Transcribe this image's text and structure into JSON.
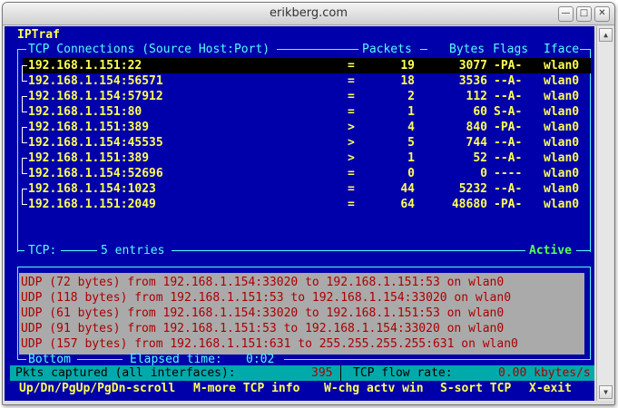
{
  "window": {
    "title": "erikberg.com"
  },
  "app": {
    "name": "IPTraf"
  },
  "header": {
    "conn_label": "TCP Connections (Source Host:Port)",
    "packets": "Packets",
    "bytes": "Bytes",
    "flags": "Flags",
    "iface": "Iface"
  },
  "connections": [
    {
      "host": "192.168.1.151:22",
      "dir": "=",
      "packets": "19",
      "bytes": "3077",
      "flags": "-PA-",
      "iface": "wlan0"
    },
    {
      "host": "192.168.1.154:56571",
      "dir": "=",
      "packets": "18",
      "bytes": "3536",
      "flags": "--A-",
      "iface": "wlan0"
    },
    {
      "host": "192.168.1.154:57912",
      "dir": "=",
      "packets": "2",
      "bytes": "112",
      "flags": "--A-",
      "iface": "wlan0"
    },
    {
      "host": "192.168.1.151:80",
      "dir": "=",
      "packets": "1",
      "bytes": "60",
      "flags": "S-A-",
      "iface": "wlan0"
    },
    {
      "host": "192.168.1.151:389",
      "dir": ">",
      "packets": "4",
      "bytes": "840",
      "flags": "-PA-",
      "iface": "wlan0"
    },
    {
      "host": "192.168.1.154:45535",
      "dir": ">",
      "packets": "5",
      "bytes": "744",
      "flags": "--A-",
      "iface": "wlan0"
    },
    {
      "host": "192.168.1.151:389",
      "dir": ">",
      "packets": "1",
      "bytes": "52",
      "flags": "--A-",
      "iface": "wlan0"
    },
    {
      "host": "192.168.1.154:52696",
      "dir": "=",
      "packets": "0",
      "bytes": "0",
      "flags": "----",
      "iface": "wlan0"
    },
    {
      "host": "192.168.1.154:1023",
      "dir": "=",
      "packets": "44",
      "bytes": "5232",
      "flags": "--A-",
      "iface": "wlan0"
    },
    {
      "host": "192.168.1.151:2049",
      "dir": "=",
      "packets": "64",
      "bytes": "48680",
      "flags": "-PA-",
      "iface": "wlan0"
    }
  ],
  "tcp_summary": {
    "label": "TCP:",
    "entries": "5 entries",
    "state": "Active"
  },
  "udp_messages": [
    "UDP (72 bytes) from 192.168.1.154:33020 to 192.168.1.151:53 on wlan0",
    "UDP (118 bytes) from 192.168.1.151:53 to 192.168.1.154:33020 on wlan0",
    "UDP (61 bytes) from 192.168.1.154:33020 to 192.168.1.151:53 on wlan0",
    "UDP (91 bytes) from 192.168.1.151:53 to 192.168.1.154:33020 on wlan0",
    "UDP (157 bytes) from 192.168.1.151:631 to 255.255.255.255:631 on wlan0"
  ],
  "bottom_border": {
    "position": "Bottom",
    "elapsed_label": "Elapsed time:",
    "elapsed": "0:02"
  },
  "stats": {
    "captured_label": "Pkts captured (all interfaces):",
    "captured": "395",
    "flow_label": "TCP flow rate:",
    "flow": "0.00 kbytes/s"
  },
  "keys": [
    {
      "key": "Up/Dn/PgUp/PgDn",
      "action": "-scroll"
    },
    {
      "key": "M",
      "action": "-more TCP info"
    },
    {
      "key": "W",
      "action": "-chg actv win"
    },
    {
      "key": "S",
      "action": "-sort TCP"
    },
    {
      "key": "X",
      "action": "-exit"
    }
  ],
  "colors": {
    "terminal_bg": "#0000aa",
    "border": "#55ffff",
    "highlight": "#ffff55",
    "active": "#55ff55",
    "udp_text": "#aa0000",
    "udp_bg": "#aaaaaa",
    "status_bg": "#00aaaa"
  }
}
